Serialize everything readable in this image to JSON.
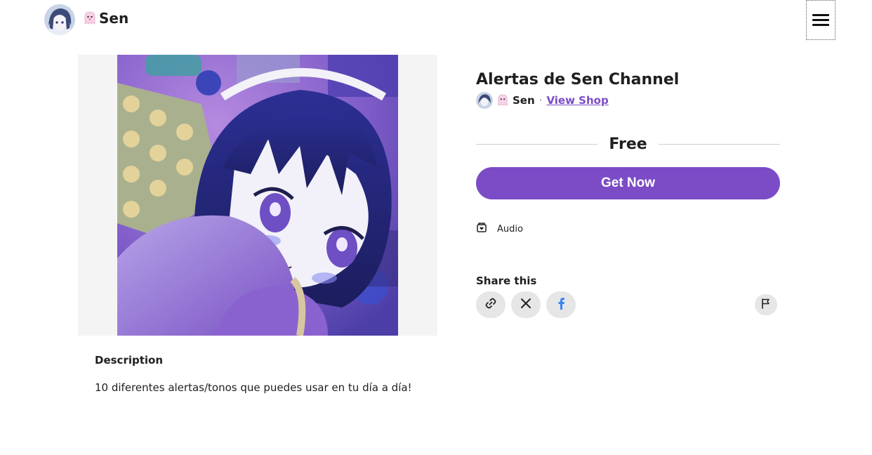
{
  "header": {
    "brand_name": "Sen",
    "avatar_icon": "user-avatar",
    "ghost_icon": "ghost-icon",
    "menu_icon": "hamburger-menu-icon"
  },
  "product": {
    "title": "Alertas de Sen Channel",
    "seller_name": "Sen",
    "separator": "·",
    "view_shop_label": "View Shop",
    "price": "Free",
    "cta_label": "Get Now",
    "category_icon": "audio-box-icon",
    "category_label": "Audio",
    "image_description": "anime-style illustration of a dark blue haired girl in a purple sweater"
  },
  "share": {
    "title": "Share this",
    "buttons": [
      {
        "icon": "link-icon"
      },
      {
        "icon": "x-logo-icon"
      },
      {
        "icon": "facebook-icon"
      }
    ],
    "report_icon": "flag-icon"
  },
  "description": {
    "title": "Description",
    "text": "10 diferentes alertas/tonos que puedes usar en tu día a día!"
  },
  "colors": {
    "accent": "#7b4cc6",
    "panel_bg": "#f4f4f4",
    "chip_bg": "#e6e6e6",
    "facebook_blue": "#3b82f6"
  }
}
